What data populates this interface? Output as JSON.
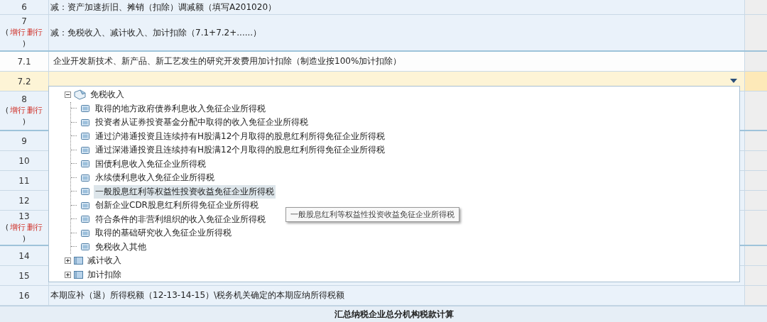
{
  "rows": [
    {
      "number": "6",
      "text": "减：资产加速折旧、摊销（扣除）调减额（填写A201020）",
      "color": "#eaf2fa",
      "selected": false
    },
    {
      "number": "7",
      "bracket_open": "(",
      "actions": [
        "增行",
        "删行"
      ],
      "bracket_close": ")",
      "text": "减：免税收入、减计收入、加计扣除（7.1+7.2+......）",
      "color": "#eaf2fa",
      "selected": false
    },
    {
      "number": "7.1",
      "text": "企业开发新技术、新产品、新工艺发生的研究开发费用加计扣除（制造业按100%加计扣除）",
      "color": "#fdfdfd",
      "selected": false
    },
    {
      "number": "7.2",
      "color": "#fdf4d6",
      "selected": true
    },
    {
      "number": "8",
      "bracket_open": "(",
      "actions": [
        "增行",
        "删行"
      ],
      "bracket_close": ")",
      "color": "#eaf2fa",
      "selected": false
    },
    {
      "number": "9",
      "color": "#eaf2fa",
      "selected": false
    },
    {
      "number": "10",
      "color": "#eaf2fa",
      "selected": false
    },
    {
      "number": "11",
      "color": "#eaf2fa",
      "selected": false
    },
    {
      "number": "12",
      "color": "#eaf2fa",
      "selected": false
    },
    {
      "number": "13",
      "bracket_open": "(",
      "actions": [
        "增行",
        "删行"
      ],
      "bracket_close": ")",
      "color": "#eaf2fa",
      "selected": false
    },
    {
      "number": "14",
      "color": "#eaf2fa",
      "selected": false
    },
    {
      "number": "15",
      "color": "#eaf2fa",
      "selected": false
    },
    {
      "number": "16",
      "text": "本期应补（退）所得税额（12-13-14-15）\\税务机关确定的本期应纳所得税额",
      "color": "#eaf2fa",
      "selected": false
    }
  ],
  "dropdown": {
    "tree": [
      {
        "label": "免税收入",
        "expanded": true,
        "children": [
          {
            "label": "取得的地方政府债券利息收入免征企业所得税",
            "selected": false
          },
          {
            "label": "投资者从证券投资基金分配中取得的收入免征企业所得税",
            "selected": false
          },
          {
            "label": "通过沪港通投资且连续持有H股满12个月取得的股息红利所得免征企业所得税",
            "selected": false
          },
          {
            "label": "通过深港通投资且连续持有H股满12个月取得的股息红利所得免征企业所得税",
            "selected": false
          },
          {
            "label": "国债利息收入免征企业所得税",
            "selected": false
          },
          {
            "label": "永续债利息收入免征企业所得税",
            "selected": false
          },
          {
            "label": "一般股息红利等权益性投资收益免征企业所得税",
            "selected": true
          },
          {
            "label": "创新企业CDR股息红利所得免征企业所得税",
            "selected": false
          },
          {
            "label": "符合条件的非营利组织的收入免征企业所得税",
            "selected": false
          },
          {
            "label": "取得的基础研究收入免征企业所得税",
            "selected": false
          },
          {
            "label": "免税收入其他",
            "selected": false
          }
        ]
      },
      {
        "label": "减计收入",
        "expanded": false
      },
      {
        "label": "加计扣除",
        "expanded": false
      }
    ],
    "tooltip": "一般股息红利等权益性投资收益免征企业所得税"
  },
  "footer": "汇总纳税企业总分机构税款计算"
}
